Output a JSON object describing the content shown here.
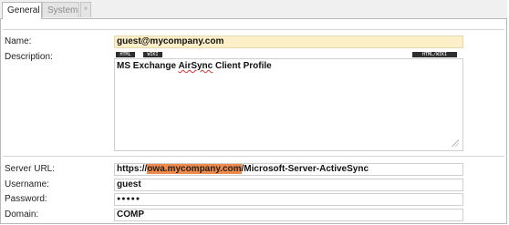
{
  "tabs": [
    {
      "label": "General"
    },
    {
      "label": "System"
    },
    {
      "label": "*"
    }
  ],
  "editor_toolbar": {
    "html_label": "HTML",
    "wiki_label": "WIKI",
    "source_label": "HTML/WIKI"
  },
  "form": {
    "name_label": "Name:",
    "name_value": "guest@mycompany.com",
    "description_label": "Description:",
    "description_pre": "MS Exchange ",
    "description_spell": "AirSync",
    "description_post": " Client Profile",
    "server_url_label": "Server URL:",
    "server_url_prefix": "https://",
    "server_url_host": "owa.mycompany.com",
    "server_url_suffix": "/Microsoft-Server-ActiveSync",
    "username_label": "Username:",
    "username_value": "guest",
    "password_label": "Password:",
    "password_value": "●●●●●",
    "domain_label": "Domain:",
    "domain_value": "COMP"
  },
  "colors": {
    "name_field_bg": "#fdf0c8",
    "url_highlight": "#f08a4b"
  }
}
